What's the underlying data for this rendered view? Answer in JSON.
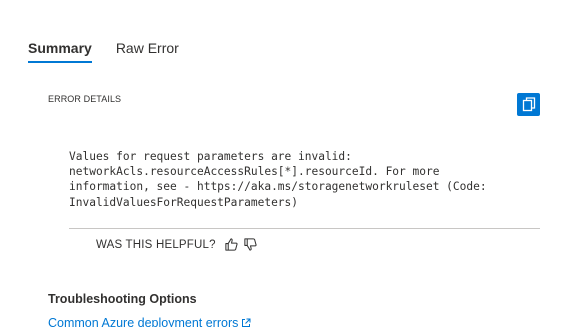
{
  "tabs": [
    {
      "label": "Summary",
      "active": true
    },
    {
      "label": "Raw Error",
      "active": false
    }
  ],
  "error_details": {
    "heading": "ERROR DETAILS",
    "copy_icon": "copy-icon",
    "message": "Values for request parameters are invalid:\nnetworkAcls.resourceAccessRules[*].resourceId. For more\ninformation, see - https://aka.ms/storagenetworkruleset (Code:\nInvalidValuesForRequestParameters)"
  },
  "feedback": {
    "label": "WAS THIS HELPFUL?",
    "thumbs_up_icon": "thumbs-up-icon",
    "thumbs_down_icon": "thumbs-down-icon"
  },
  "troubleshooting": {
    "title": "Troubleshooting Options",
    "links": [
      {
        "label": "Common Azure deployment errors",
        "icon": "external-link-icon"
      }
    ]
  },
  "colors": {
    "accent": "#0078d4",
    "text": "#323130",
    "divider": "#c8c6c4"
  }
}
